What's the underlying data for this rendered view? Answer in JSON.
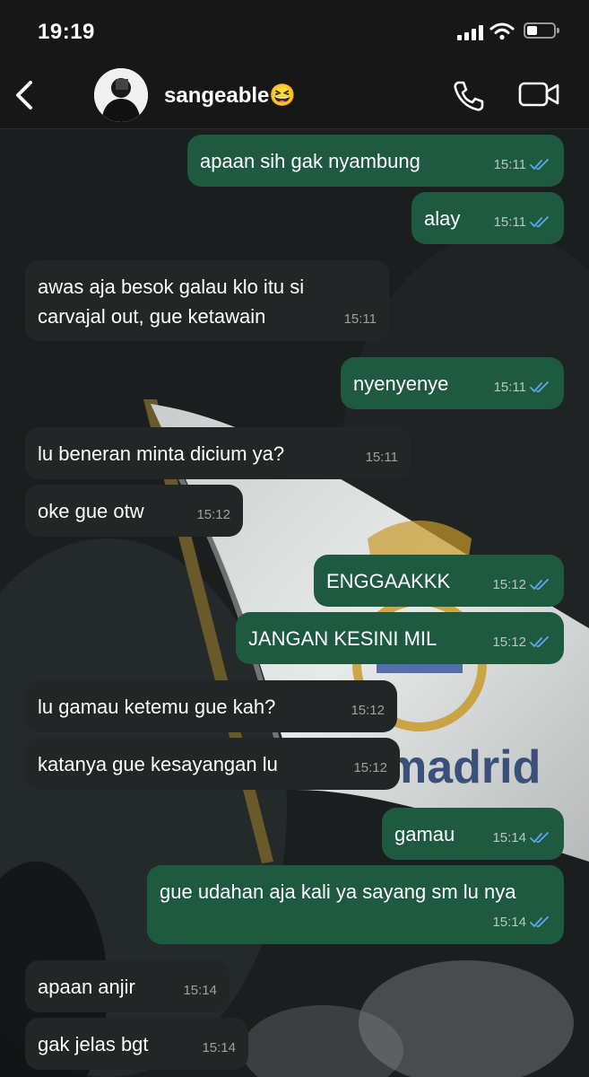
{
  "status_bar": {
    "time": "19:19"
  },
  "header": {
    "contact_name": "sangeable😆"
  },
  "colors": {
    "outgoing_bubble": "#1e5a3f",
    "incoming_bubble": "#232626",
    "read_ticks": "#5aa8f0"
  },
  "icons": {
    "back": "chevron-left-icon",
    "call": "phone-icon",
    "video": "video-camera-icon",
    "read": "double-check-icon"
  },
  "messages": [
    {
      "dir": "out",
      "text": "apaan sih gak nyambung",
      "time": "15:11",
      "read": true
    },
    {
      "dir": "out",
      "text": "alay",
      "time": "15:11",
      "read": true
    },
    {
      "dir": "in",
      "text": "awas aja besok galau klo itu si carvajal out, gue ketawain",
      "time": "15:11"
    },
    {
      "dir": "out",
      "text": "nyenyenye",
      "time": "15:11",
      "read": true
    },
    {
      "dir": "in",
      "text": "lu beneran minta dicium ya?",
      "time": "15:11"
    },
    {
      "dir": "in",
      "text": "oke gue otw",
      "time": "15:12"
    },
    {
      "dir": "out",
      "text": "ENGGAAKKK",
      "time": "15:12",
      "read": true
    },
    {
      "dir": "out",
      "text": "JANGAN KESINI MIL",
      "time": "15:12",
      "read": true
    },
    {
      "dir": "in",
      "text": "lu gamau ketemu gue kah?",
      "time": "15:12"
    },
    {
      "dir": "in",
      "text": "katanya gue kesayangan lu",
      "time": "15:12"
    },
    {
      "dir": "out",
      "text": "gamau",
      "time": "15:14",
      "read": true
    },
    {
      "dir": "out",
      "text": "gue udahan aja kali ya sayang sm lu nya",
      "time": "15:14",
      "read": true
    },
    {
      "dir": "in",
      "text": "apaan anjir",
      "time": "15:14"
    },
    {
      "dir": "in",
      "text": "gak jelas bgt",
      "time": "15:14"
    }
  ],
  "wallpaper": {
    "flag_text": "madrid"
  }
}
